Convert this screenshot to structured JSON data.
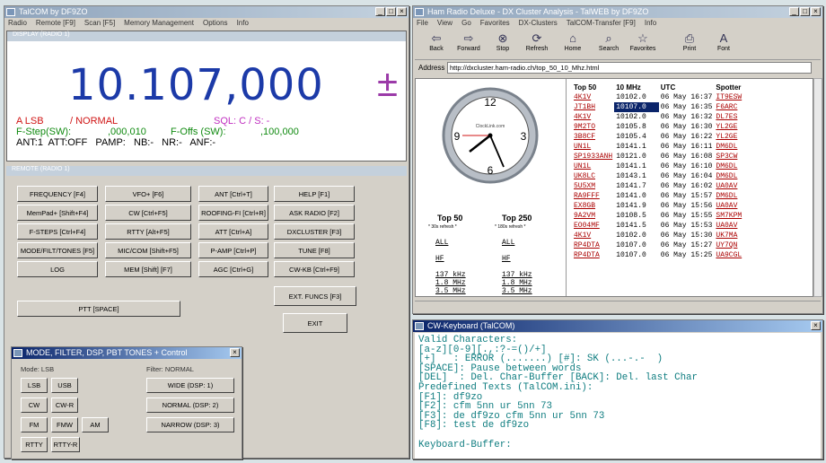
{
  "talcom": {
    "title": "TalCOM by DF9ZO",
    "menu": [
      "Radio",
      "Remote [F9]",
      "Scan [F5]",
      "Memory Management",
      "Options",
      "Info"
    ],
    "display_label": "DISPLAY (RADIO 1)",
    "frequency": "10.107,000",
    "freq_suffix": "±",
    "mode": "A LSB",
    "mode2": "/ NORMAL",
    "sql": "SQL: C / S: -",
    "fstep": "F-Step(SW):",
    "fstep_val": ",000,010",
    "foffs": "F-Offs (SW):",
    "foffs_val": ",100,000",
    "status": "ANT:1  ATT:OFF   PAMP:   NB:-   NR:-   ANF:-",
    "remote_label": "REMOTE (RADIO 1)",
    "buttons": [
      "FREQUENCY [F4]",
      "VFO+ [F6]",
      "ANT [Ctrl+T]",
      "HELP [F1]",
      "MemPad+ [Shift+F4]",
      "CW [Ctrl+F5]",
      "ROOFING-FI [Ctrl+R]",
      "ASK RADIO [F2]",
      "F-STEPS [Ctrl+F4]",
      "RTTY [Alt+F5]",
      "ATT [Ctrl+A]",
      "DXCLUSTER [F3]",
      "MODE/FILT/TONES [F5]",
      "MIC/COM [Shift+F5]",
      "P-AMP [Ctrl+P]",
      "TUNE [F8]",
      "LOG",
      "MEM [Shift] [F7]",
      "AGC [Ctrl+G]",
      "CW-KB [Ctrl+F9]"
    ],
    "ext_funcs": "EXT. FUNCS [F3]",
    "ptt": "PTT [SPACE]",
    "exit": "EXIT"
  },
  "modewin": {
    "title": "MODE, FILTER, DSP, PBT TONES + Control",
    "mode_label": "Mode: LSB",
    "filter_label": "Filter: NORMAL",
    "modes": [
      "LSB",
      "USB",
      "CW",
      "CW-R",
      "FM",
      "FMW",
      "AM",
      "RTTY",
      "RTTY-R"
    ],
    "filters": [
      "WIDE (DSP: 1)",
      "NORMAL (DSP: 2)",
      "NARROW (DSP: 3)"
    ]
  },
  "browser": {
    "title": "Ham Radio Deluxe - DX Cluster Analysis - TalWEB by DF9ZO",
    "menu": [
      "File",
      "View",
      "Go",
      "Favorites",
      "DX-Clusters",
      "TalCOM-Transfer [F9]",
      "Info"
    ],
    "toolbar": [
      "Back",
      "Forward",
      "Stop",
      "Refresh",
      "Home",
      "Search",
      "Favorites",
      "Print",
      "Font"
    ],
    "address_label": "Address",
    "address": "http://dxcluster.ham-radio.ch/top_50_10_Mhz.html",
    "clock_brand": "ClockLink.com",
    "top50": "Top 50",
    "top50_note": "* 30s refresh *",
    "top250": "Top 250",
    "top250_note": "* 180s refresh *",
    "left_links": [
      [
        "ALL",
        "ALL"
      ],
      [
        "HF",
        "HF"
      ],
      [
        "137 kHz",
        "137 kHz"
      ],
      [
        "1.8 MHz",
        "1.8 MHz"
      ],
      [
        "3.5 MHz",
        "3.5 MHz"
      ]
    ],
    "headers": [
      "Top 50",
      "10 MHz",
      "UTC",
      "Spotter"
    ],
    "rows": [
      [
        "4K1V",
        "10102.0",
        "06 May 16:37",
        "IT9ESW"
      ],
      [
        "JT1BH",
        "10107.0",
        "06 May 16:35",
        "F6ARC"
      ],
      [
        "4K1V",
        "10102.0",
        "06 May 16:32",
        "DL7ES"
      ],
      [
        "9M2TO",
        "10105.8",
        "06 May 16:30",
        "YL2GE"
      ],
      [
        "3B8CF",
        "10105.4",
        "06 May 16:22",
        "YL2GE"
      ],
      [
        "UN1L",
        "10141.1",
        "06 May 16:11",
        "DM6DL"
      ],
      [
        "SP1933ANH",
        "10121.0",
        "06 May 16:08",
        "SP3CW"
      ],
      [
        "UN1L",
        "10141.1",
        "06 May 16:10",
        "DM6DL"
      ],
      [
        "UK8LC",
        "10143.1",
        "06 May 16:04",
        "DM6DL"
      ],
      [
        "5U5XM",
        "10141.7",
        "06 May 16:02",
        "UA0AV"
      ],
      [
        "RA9FFF",
        "10141.0",
        "06 May 15:57",
        "DM6DL"
      ],
      [
        "EX8GB",
        "10141.9",
        "06 May 15:56",
        "UA0AV"
      ],
      [
        "9A2VM",
        "10108.5",
        "06 May 15:55",
        "SM7KPM"
      ],
      [
        "EO04MF",
        "10141.5",
        "06 May 15:53",
        "UA0AV"
      ],
      [
        "4K1V",
        "10102.0",
        "06 May 15:30",
        "UK7MA"
      ],
      [
        "RP4DTA",
        "10107.0",
        "06 May 15:27",
        "UY7QN"
      ],
      [
        "RP4DTA",
        "10107.0",
        "06 May 15:25",
        "UA9CGL"
      ]
    ]
  },
  "cw": {
    "title": "CW-Keyboard (TalCOM)",
    "lines": [
      "Valid Characters:",
      "[a-z][0-9][.,:?-=()/+]",
      "[+]   : ERROR (.......) [#]: SK (...-.-  )",
      "[SPACE]: Pause between words",
      "[DEL]  : Del. Char-Buffer [BACK]: Del. last Char",
      "Predefined Texts (TalCOM.ini):",
      "[F1]: df9zo",
      "[F2]: cfm 5nn ur 5nn 73",
      "[F3]: de df9zo cfm 5nn ur 5nn 73",
      "[F8]: test de df9zo",
      "",
      "Keyboard-Buffer:"
    ]
  },
  "colors": {
    "freq": "#1c3aa8",
    "red": "#d01515",
    "green": "#108a10",
    "cwtext": "#0f7d80",
    "link": "#a00000"
  }
}
